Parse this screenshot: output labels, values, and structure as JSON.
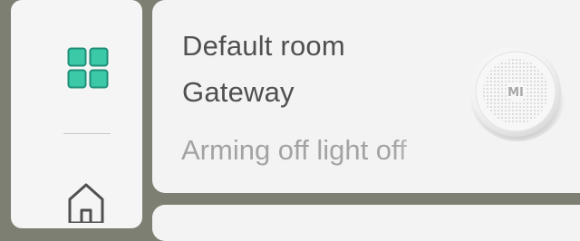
{
  "card": {
    "room": "Default room",
    "device_name": "Gateway",
    "status": "Arming off light off"
  },
  "device": {
    "logo_text": "MI"
  },
  "colors": {
    "accent": "#3cc9a8",
    "background": "#7d7f72",
    "card": "#f3f3f3"
  },
  "icons": {
    "nav_grid": "grid-icon",
    "nav_home": "home-icon"
  }
}
